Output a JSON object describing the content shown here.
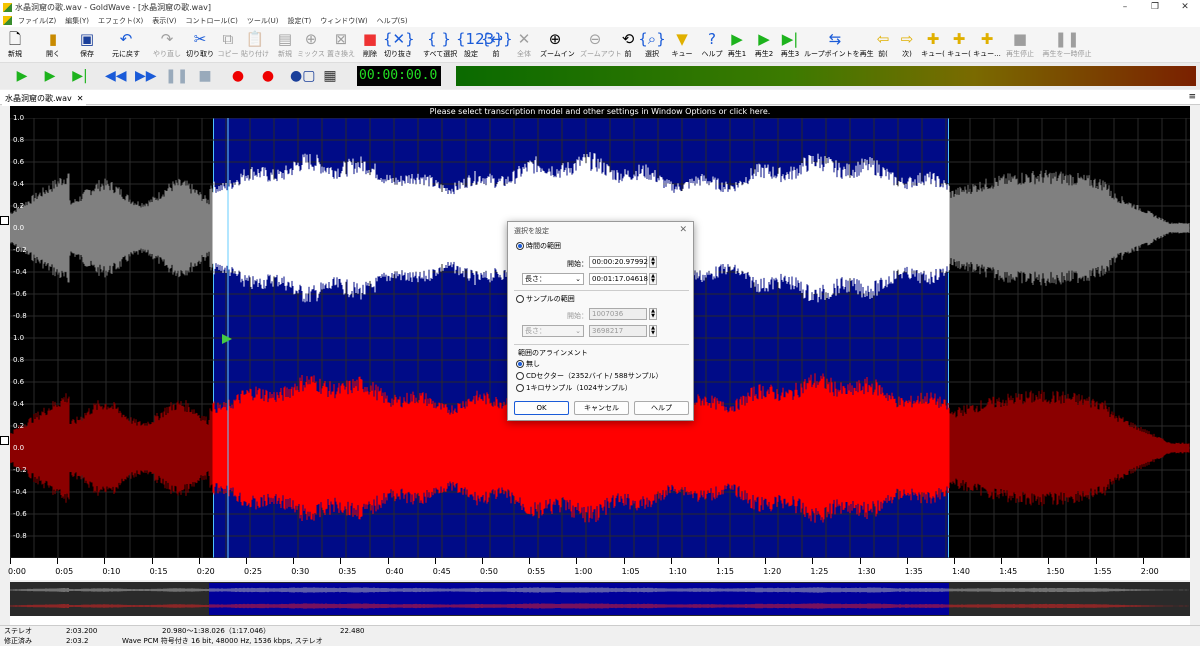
{
  "window": {
    "title": "水晶洞窟の歌.wav - GoldWave - [水晶洞窟の歌.wav]"
  },
  "menu": [
    "ファイル(Z)",
    "編集(Y)",
    "エフェクト(X)",
    "表示(V)",
    "コントロール(C)",
    "ツール(U)",
    "設定(T)",
    "ウィンドウ(W)",
    "ヘルプ(S)"
  ],
  "toolbar": {
    "new": "新規",
    "open": "開く",
    "save": "保存",
    "undo": "元に戻す",
    "redo": "やり直し",
    "cut": "切り取り",
    "copy": "コピー",
    "paste": "貼り付け",
    "paste_new": "新規",
    "mix": "ミックス",
    "replace": "置き換え",
    "delete": "削除",
    "trim": "切り抜き",
    "select_all": "すべて選択",
    "set": "設定",
    "prev": "前",
    "all": "全体",
    "zoom_in": "ズームイン",
    "zoom_out": "ズームアウト",
    "prev2": "前",
    "select": "選択",
    "cue": "キュー",
    "help": "ヘルプ",
    "play1": "再生1",
    "play2": "再生2",
    "play3": "再生3",
    "loop_play": "ループポイントを再生",
    "cue_prev": "前(",
    "cue_next": "次)",
    "cue_add1": "キュー(",
    "cue_add2": "キュー(",
    "cue_add3": "キュー...",
    "stop_play": "再生停止",
    "pause_play": "再生を一時停止"
  },
  "time_display": "00:00:00.0",
  "tab": {
    "label": "水晶洞窟の歌.wav",
    "close": "✕"
  },
  "info_line": "Please select transcription model and other settings in Window Options or click here.",
  "yaxis": [
    "1.0",
    "0.8",
    "0.6",
    "0.4",
    "0.2",
    "0.0",
    "-0.2",
    "-0.4",
    "-0.6",
    "-0.8"
  ],
  "timeline": [
    "0:00",
    "0:05",
    "0:10",
    "0:15",
    "0:20",
    "0:25",
    "0:30",
    "0:35",
    "0:40",
    "0:45",
    "0:50",
    "0:55",
    "1:00",
    "1:05",
    "1:10",
    "1:15",
    "1:20",
    "1:25",
    "1:30",
    "1:35",
    "1:40",
    "1:45",
    "1:50",
    "1:55",
    "2:00"
  ],
  "status": {
    "row1": {
      "mode": "ステレオ",
      "length": "2:03.200",
      "range": "20.980～1:38.026（1:17.046）",
      "position": "22.480"
    },
    "row2": {
      "state": "修正済み",
      "length2": "2:03.2",
      "format": "Wave PCM 符号付き 16 bit, 48000 Hz, 1536 kbps, ステレオ"
    }
  },
  "dialog": {
    "title": "選択を設定",
    "time_range": "時間の範囲",
    "start_label": "開始：",
    "start_value": "00:00:20.97992",
    "length_select": "長さ：",
    "length_value": "00:01:17.04618",
    "sample_range": "サンプルの範囲",
    "sample_start_label": "開始：",
    "sample_start_value": "1007036",
    "sample_length_select": "長さ：",
    "sample_length_value": "3698217",
    "align_group": "範囲のアラインメント",
    "align_none": "無し",
    "align_cd": "CDセクター（2352バイト/ 588サンプル）",
    "align_1k": "1キロサンプル（1024サンプル）",
    "ok": "OK",
    "cancel": "キャンセル",
    "help": "ヘルプ"
  },
  "colors": {
    "selection": "#000b87",
    "left_channel": "#ffffff",
    "right_channel": "#ff0000",
    "unselected_left": "#808080",
    "unselected_right": "#8b0000"
  }
}
